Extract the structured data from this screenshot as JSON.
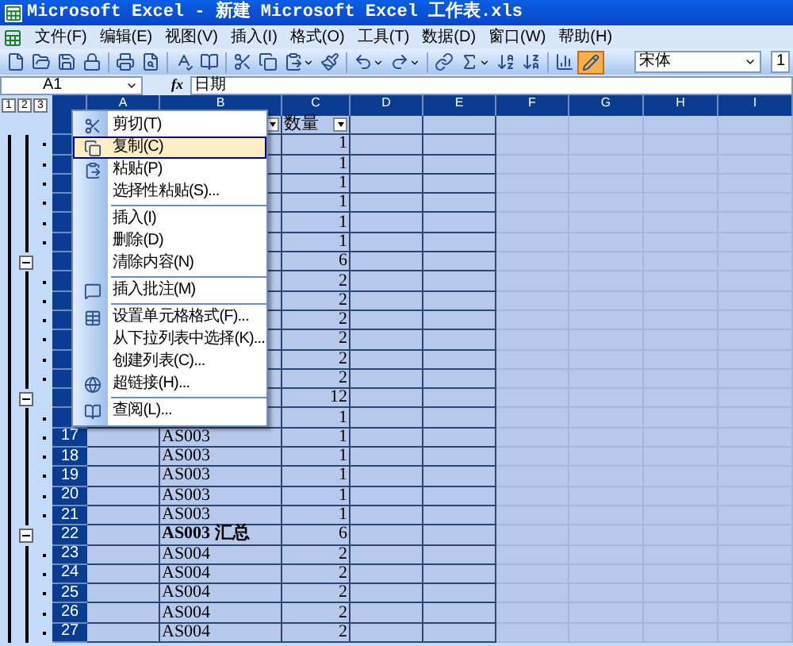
{
  "window": {
    "title": "Microsoft Excel - 新建 Microsoft Excel 工作表.xls"
  },
  "menu_bar": [
    "文件(F)",
    "编辑(E)",
    "视图(V)",
    "插入(I)",
    "格式(O)",
    "工具(T)",
    "数据(D)",
    "窗口(W)",
    "帮助(H)"
  ],
  "toolbar": {
    "font_name": "宋体",
    "font_size": "1"
  },
  "formula_bar": {
    "name_box": "A1",
    "function_label": "fx",
    "formula": "日期"
  },
  "outline_levels": [
    "1",
    "2",
    "3"
  ],
  "columns": [
    {
      "label": "A",
      "selected": true,
      "in_list": true
    },
    {
      "label": "B",
      "selected": true,
      "in_list": true
    },
    {
      "label": "C",
      "selected": true,
      "in_list": true
    },
    {
      "label": "D",
      "selected": true,
      "in_list": true
    },
    {
      "label": "E",
      "selected": true,
      "in_list": true
    },
    {
      "label": "F",
      "selected": true,
      "in_list": false
    },
    {
      "label": "G",
      "selected": true,
      "in_list": false
    },
    {
      "label": "H",
      "selected": true,
      "in_list": false
    },
    {
      "label": "I",
      "selected": true,
      "in_list": false
    }
  ],
  "rows": [
    {
      "kind": "header",
      "filters": true,
      "c": "数量"
    },
    {
      "kind": "detail",
      "c": "1"
    },
    {
      "kind": "detail",
      "c": "1"
    },
    {
      "kind": "detail",
      "c": "1"
    },
    {
      "kind": "detail",
      "c": "1"
    },
    {
      "kind": "detail",
      "c": "1"
    },
    {
      "kind": "detail",
      "c": "1"
    },
    {
      "kind": "summary",
      "c": "6"
    },
    {
      "kind": "detail",
      "c": "2"
    },
    {
      "kind": "detail",
      "c": "2"
    },
    {
      "kind": "detail",
      "c": "2"
    },
    {
      "kind": "detail",
      "c": "2"
    },
    {
      "kind": "detail",
      "c": "2"
    },
    {
      "kind": "detail",
      "c": "2"
    },
    {
      "kind": "summary",
      "c": "12"
    },
    {
      "kind": "detail",
      "c": "1"
    },
    {
      "header": "17",
      "kind": "detail",
      "b": "AS003",
      "c": "1"
    },
    {
      "header": "18",
      "kind": "detail",
      "b": "AS003",
      "c": "1"
    },
    {
      "header": "19",
      "kind": "detail",
      "b": "AS003",
      "c": "1"
    },
    {
      "header": "20",
      "kind": "detail",
      "b": "AS003",
      "c": "1"
    },
    {
      "header": "21",
      "kind": "detail",
      "b": "AS003",
      "c": "1"
    },
    {
      "header": "22",
      "kind": "summary",
      "b": "AS003 汇总",
      "bold": true,
      "c": "6"
    },
    {
      "header": "23",
      "kind": "detail",
      "b": "AS004",
      "c": "2"
    },
    {
      "header": "24",
      "kind": "detail",
      "b": "AS004",
      "c": "2"
    },
    {
      "header": "25",
      "kind": "detail",
      "b": "AS004",
      "c": "2"
    },
    {
      "header": "26",
      "kind": "detail",
      "b": "AS004",
      "c": "2"
    },
    {
      "header": "27",
      "kind": "detail",
      "b": "AS004",
      "c": "2"
    }
  ],
  "context_menu": {
    "items": [
      {
        "kind": "command",
        "label": "剪切(T)",
        "selected": false
      },
      {
        "kind": "command",
        "label": "复制(C)",
        "selected": true
      },
      {
        "kind": "command",
        "label": "粘贴(P)",
        "selected": false
      },
      {
        "kind": "command",
        "label": "选择性粘贴(S)...",
        "selected": false
      },
      {
        "kind": "separator"
      },
      {
        "kind": "command",
        "label": "插入(I)",
        "selected": false
      },
      {
        "kind": "command",
        "label": "删除(D)",
        "selected": false
      },
      {
        "kind": "command",
        "label": "清除内容(N)",
        "selected": false
      },
      {
        "kind": "separator"
      },
      {
        "kind": "command",
        "label": "插入批注(M)",
        "selected": false
      },
      {
        "kind": "separator"
      },
      {
        "kind": "command",
        "label": "设置单元格格式(F)...",
        "selected": false
      },
      {
        "kind": "command",
        "label": "从下拉列表中选择(K)...",
        "selected": false
      },
      {
        "kind": "command",
        "label": "创建列表(C)...",
        "selected": false
      },
      {
        "kind": "command",
        "label": "超链接(H)...",
        "selected": false
      },
      {
        "kind": "separator"
      },
      {
        "kind": "command",
        "label": "查阅(L)...",
        "selected": false
      }
    ]
  }
}
